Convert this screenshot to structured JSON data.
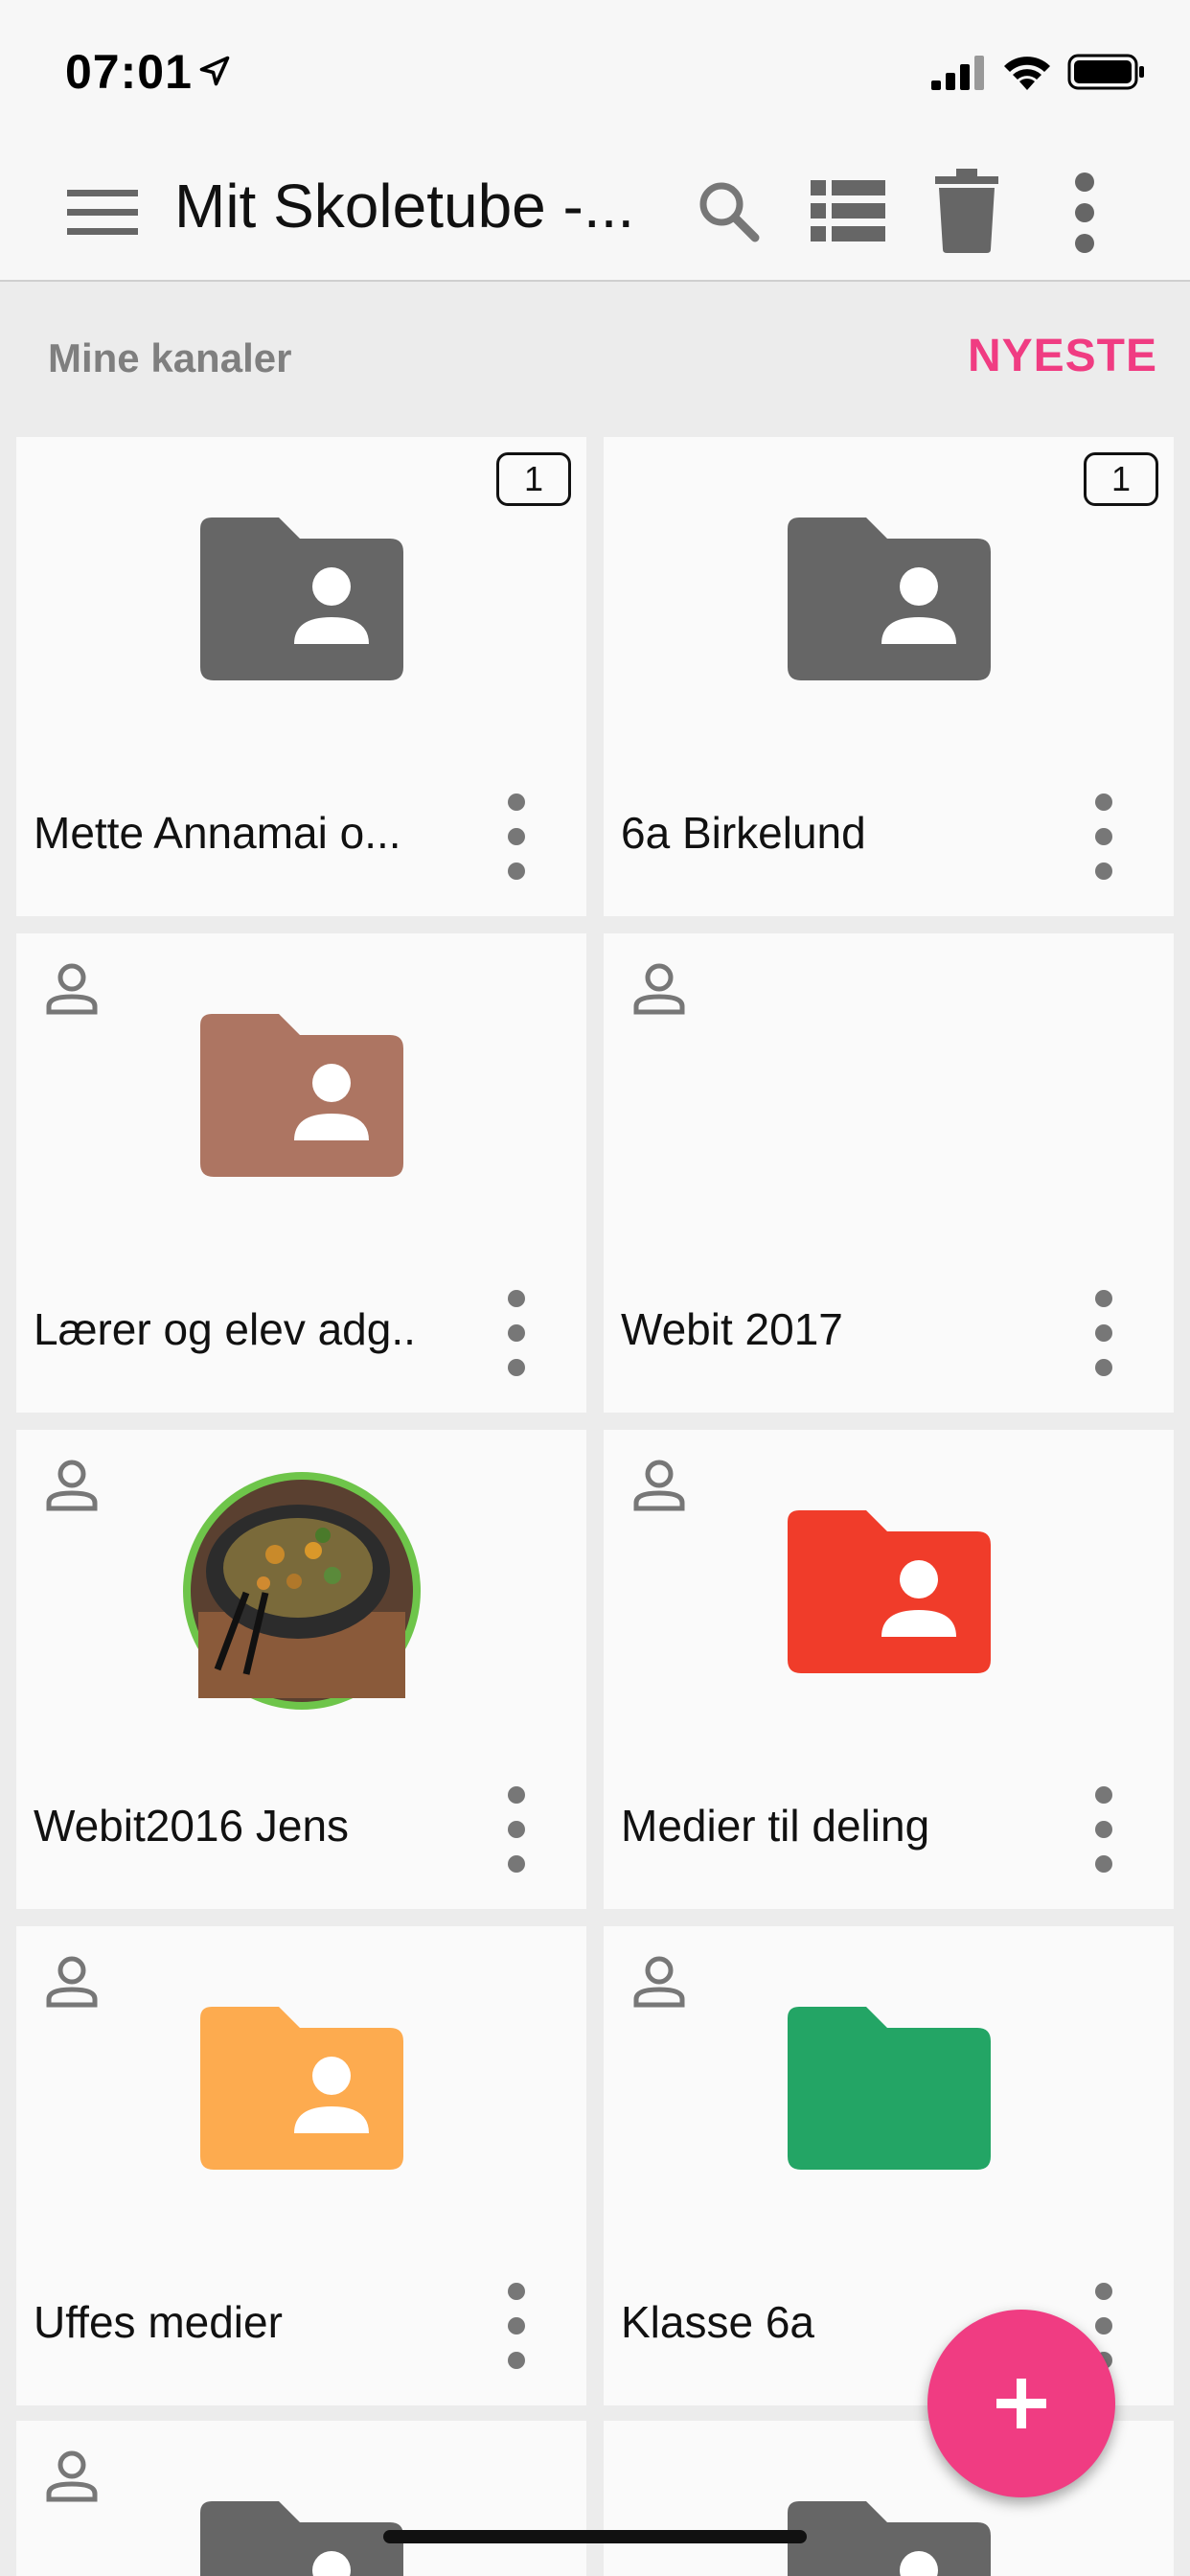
{
  "status": {
    "time": "07:01"
  },
  "appbar": {
    "title": "Mit Skoletube -..."
  },
  "section": {
    "title": "Mine kanaler",
    "sort_label": "NYESTE"
  },
  "channels": [
    {
      "name": "Mette Annamai o...",
      "count": "1",
      "icon": "folder-person-icon",
      "color": "#666666"
    },
    {
      "name": "6a Birkelund",
      "count": "1",
      "icon": "folder-person-icon",
      "color": "#666666"
    },
    {
      "name": "Lærer og elev adg...",
      "icon": "folder-person-icon",
      "color": "#ad7562"
    },
    {
      "name": "Webit 2017",
      "icon": "none"
    },
    {
      "name": "Webit2016 Jens",
      "icon": "food-thumbnail"
    },
    {
      "name": "Medier til deling",
      "icon": "folder-person-icon",
      "color": "#f03c2a"
    },
    {
      "name": "Uffes medier",
      "icon": "folder-person-icon",
      "color": "#fdab4f"
    },
    {
      "name": "Klasse 6a",
      "icon": "folder-icon",
      "color": "#23a565"
    }
  ],
  "fab": {
    "icon": "plus-icon",
    "color": "#f03c82"
  }
}
